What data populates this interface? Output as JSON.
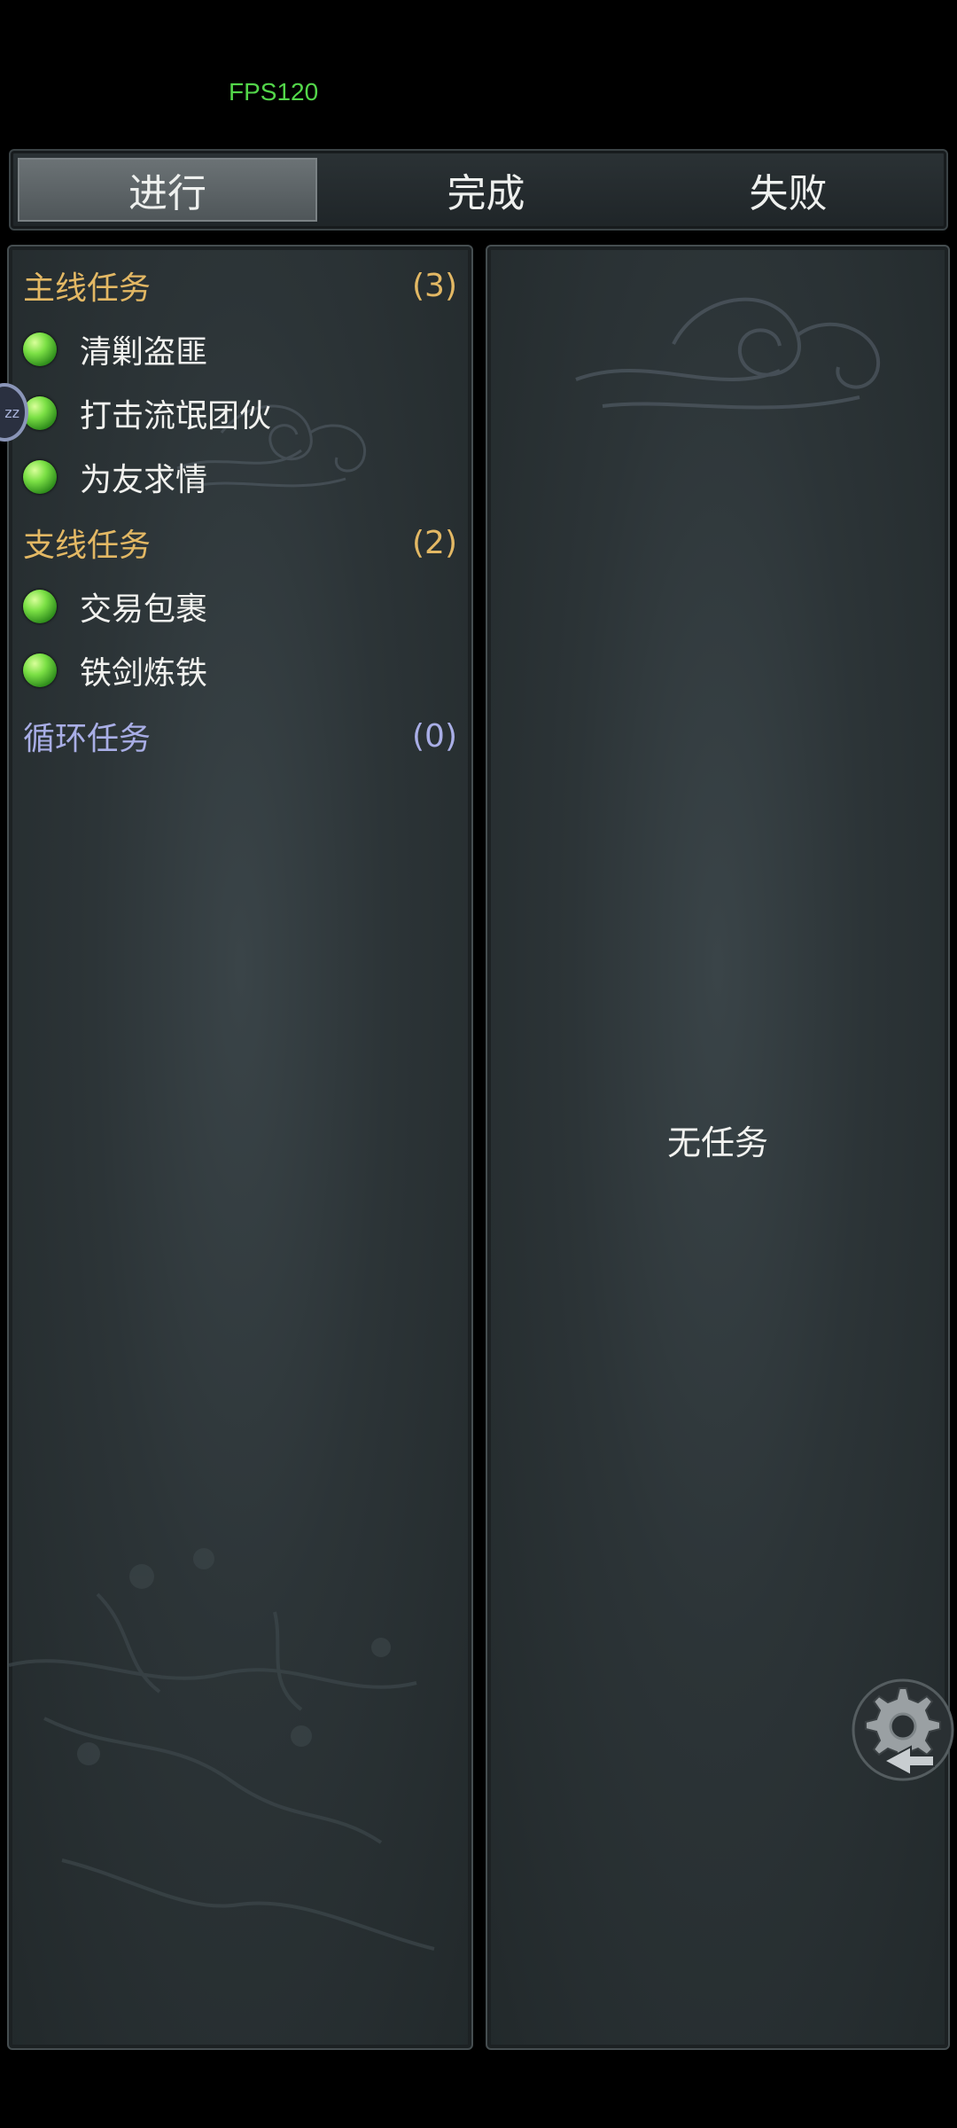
{
  "hud": {
    "fps": "FPS120"
  },
  "tabs": [
    {
      "label": "进行",
      "active": true
    },
    {
      "label": "完成",
      "active": false
    },
    {
      "label": "失败",
      "active": false
    }
  ],
  "categories": {
    "main": {
      "title": "主线任务",
      "count": "(3)",
      "quests": [
        "清剿盗匪",
        "打击流氓团伙",
        "为友求情"
      ]
    },
    "side": {
      "title": "支线任务",
      "count": "(2)",
      "quests": [
        "交易包裹",
        "铁剑炼铁"
      ]
    },
    "loop": {
      "title": "循环任务",
      "count": "(0)",
      "quests": []
    }
  },
  "detail": {
    "empty_text": "无任务"
  },
  "side_handle": {
    "text": "zz"
  },
  "icons": {
    "quest_marker": "green-orb-icon",
    "settings": "gear-back-icon"
  },
  "colors": {
    "main_category": "#e3b864",
    "loop_category": "#a9aee6",
    "fps": "#53d64a"
  }
}
